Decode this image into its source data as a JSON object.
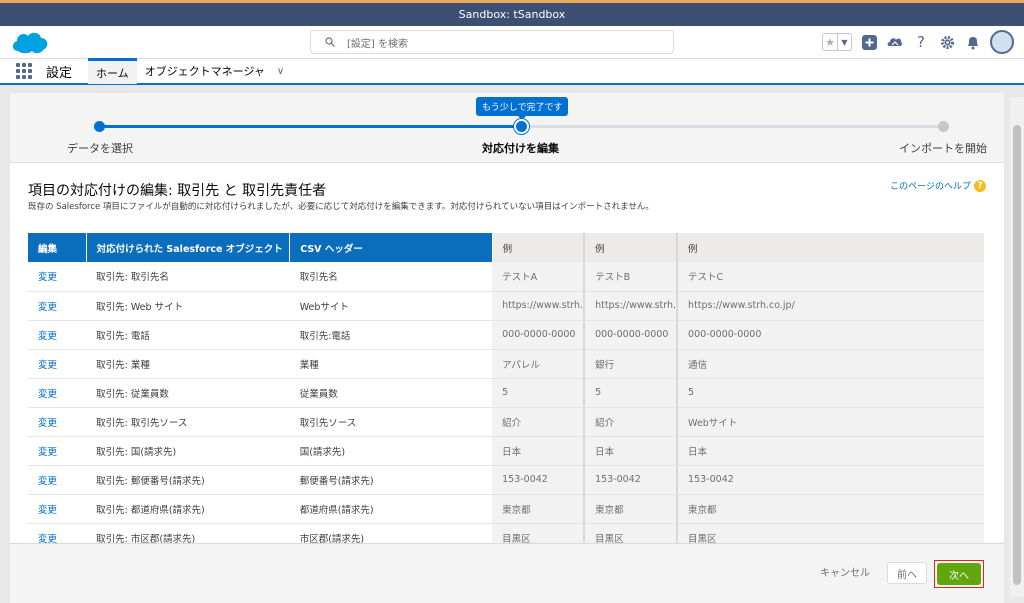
{
  "window": {
    "title": "Sandbox: tSandbox"
  },
  "header": {
    "search_placeholder": "[設定] を検索",
    "icons": [
      "favorites-star-icon",
      "favorites-dropdown-icon",
      "add-icon",
      "trailhead-icon",
      "help-icon",
      "setup-gear-icon",
      "notification-bell-icon",
      "avatar"
    ]
  },
  "nav": {
    "app_name": "設定",
    "tabs": [
      {
        "label": "ホーム"
      },
      {
        "label": "オブジェクトマネージャ"
      }
    ]
  },
  "progress": {
    "tooltip": "もう少しで完了です",
    "steps": [
      {
        "label": "データを選択"
      },
      {
        "label": "対応付けを編集"
      },
      {
        "label": "インポートを開始"
      }
    ],
    "current_step": 2,
    "total_steps": 3
  },
  "page": {
    "title": "項目の対応付けの編集: 取引先 と 取引先責任者",
    "description": "既存の Salesforce 項目にファイルが自動的に対応付けられましたが、必要に応じて対応付けを編集できます。対応付けられていない項目はインポートされません。",
    "help_link": "このページのヘルプ"
  },
  "table": {
    "headers": [
      "編集",
      "対応付けられた Salesforce オブジェクト",
      "CSV ヘッダー",
      "例",
      "例",
      "例"
    ],
    "rows": [
      [
        "変更",
        "取引先: 取引先名",
        "取引先名",
        "テストA",
        "テストB",
        "テストC"
      ],
      [
        "変更",
        "取引先: Web サイト",
        "Webサイト",
        "https://www.strh.",
        "https://www.strh.",
        "https://www.strh.co.jp/"
      ],
      [
        "変更",
        "取引先: 電話",
        "取引先:電話",
        "000-0000-0000",
        "000-0000-0000",
        "000-0000-0000"
      ],
      [
        "変更",
        "取引先: 業種",
        "業種",
        "アパレル",
        "銀行",
        "通信"
      ],
      [
        "変更",
        "取引先: 従業員数",
        "従業員数",
        "5",
        "5",
        "5"
      ],
      [
        "変更",
        "取引先: 取引先ソース",
        "取引先ソース",
        "紹介",
        "紹介",
        "Webサイト"
      ],
      [
        "変更",
        "取引先: 国(請求先)",
        "国(請求先)",
        "日本",
        "日本",
        "日本"
      ],
      [
        "変更",
        "取引先: 郵便番号(請求先)",
        "郵便番号(請求先)",
        "153-0042",
        "153-0042",
        "153-0042"
      ],
      [
        "変更",
        "取引先: 都道府県(請求先)",
        "都道府県(請求先)",
        "東京都",
        "東京都",
        "東京都"
      ],
      [
        "変更",
        "取引先: 市区郡(請求先)",
        "市区郡(請求先)",
        "目黒区",
        "目黒区",
        "目黒区"
      ]
    ]
  },
  "footer": {
    "cancel": "キャンセル",
    "prev": "前へ",
    "next": "次へ"
  },
  "colors": {
    "brand": "#0070d2",
    "header_blue": "#0a6ebd",
    "next_green": "#62a60e",
    "highlight_red": "#e5251b"
  }
}
